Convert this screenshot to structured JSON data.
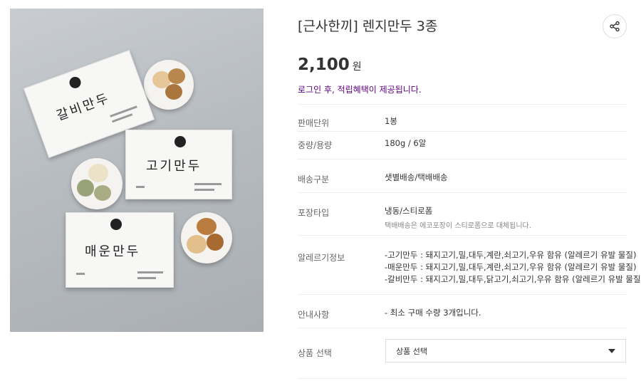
{
  "product": {
    "title": "[근사한끼] 렌지만두 3종",
    "price": "2,100",
    "currency": "원",
    "benefit_notice": "로그인 후, 적립혜택이 제공됩니다."
  },
  "details": {
    "unit_label": "판매단위",
    "unit_value": "1봉",
    "weight_label": "중량/용량",
    "weight_value": "180g / 6알",
    "delivery_label": "배송구분",
    "delivery_value": "샛별배송/택배배송",
    "packaging_label": "포장타입",
    "packaging_value": "냉동/스티로폼",
    "packaging_note": "택배배송은 에코포장이 스티로폼으로 대체됩니다.",
    "allergy_label": "알레르기정보",
    "allergy_lines": [
      "-고기만두 : 돼지고기,밀,대두,계란,쇠고기,우유 함유 (알레르기 유발 물질)",
      "-매운만두 : 돼지고기,밀,대두,계란,쇠고기,우유 함유 (알레르기 유발 물질)",
      "-갈비만두 : 돼지고기,밀,대두,닭고기,쇠고기,우유 함유 (알레르기 유발 물질)"
    ],
    "notice_label": "안내사항",
    "notice_value": "- 최소 구매 수량 3개입니다."
  },
  "selection": {
    "label": "상품 선택",
    "placeholder": "상품 선택"
  },
  "image": {
    "pack_names": [
      "갈비만두",
      "고기만두",
      "매운만두"
    ]
  },
  "icons": {
    "share": "share-icon",
    "dropdown": "triangle-down-icon"
  },
  "colors": {
    "accent": "#5f0080",
    "text": "#333333"
  }
}
